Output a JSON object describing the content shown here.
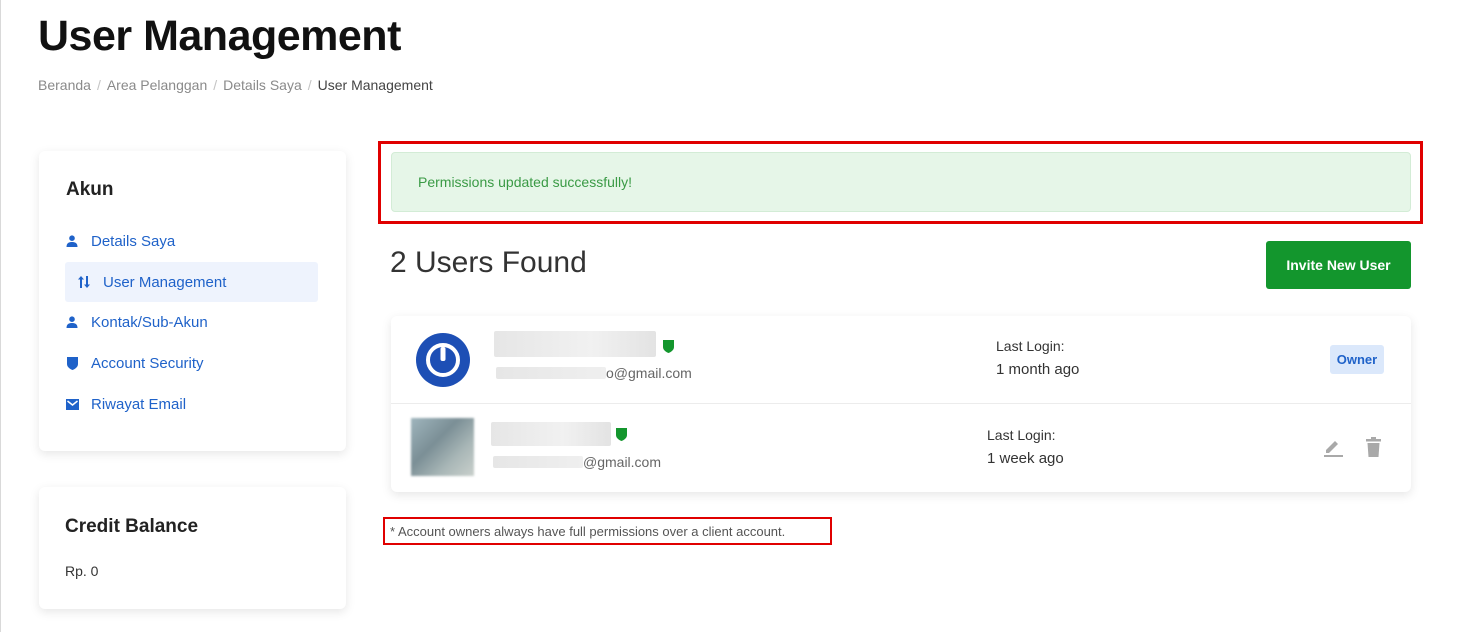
{
  "page": {
    "title": "User Management",
    "breadcrumb": [
      "Beranda",
      "Area Pelanggan",
      "Details Saya",
      "User Management"
    ]
  },
  "sidebar": {
    "heading": "Akun",
    "items": [
      {
        "label": "Details Saya",
        "icon": "person-icon"
      },
      {
        "label": "User Management",
        "icon": "sort-arrows-icon",
        "active": true
      },
      {
        "label": "Kontak/Sub-Akun",
        "icon": "person-icon"
      },
      {
        "label": "Account Security",
        "icon": "shield-icon"
      },
      {
        "label": "Riwayat Email",
        "icon": "envelope-icon"
      }
    ]
  },
  "credit": {
    "heading": "Credit Balance",
    "value": "Rp. 0"
  },
  "alert": {
    "message": "Permissions updated successfully!"
  },
  "users": {
    "count_label": "2 Users Found",
    "invite_label": "Invite New User",
    "rows": [
      {
        "email_suffix": "o@gmail.com",
        "login_label": "Last Login:",
        "login_value": "1 month ago",
        "badge": "Owner"
      },
      {
        "email_suffix": "@gmail.com",
        "login_label": "Last Login:",
        "login_value": "1 week ago"
      }
    ]
  },
  "footnote": "* Account owners always have full permissions over a client account.",
  "colors": {
    "accent_blue": "#1f62c9",
    "success_green": "#13962d",
    "alert_bg": "#e6f6e8",
    "highlight_red": "#e00000"
  }
}
